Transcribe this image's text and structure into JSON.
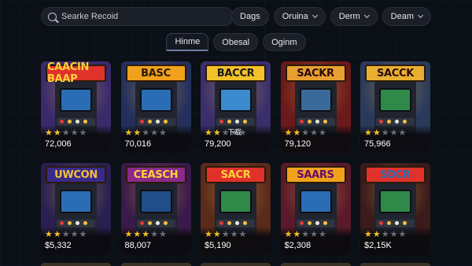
{
  "search": {
    "placeholder": "Searke Recoid"
  },
  "filters": [
    {
      "label": "Dags"
    },
    {
      "label": "Oruina"
    },
    {
      "label": "Derm"
    },
    {
      "label": "Deam"
    }
  ],
  "tabs": [
    {
      "label": "Hinme",
      "active": true
    },
    {
      "label": "Obesal",
      "active": false
    },
    {
      "label": "Oginm",
      "active": false
    }
  ],
  "colors": {
    "star_on": "#f4c21f",
    "star_off": "#6b6f78",
    "background": "#0b0f16"
  },
  "icons": {
    "search": "search-icon",
    "dropdown": "chevron-down-icon",
    "star": "star-icon"
  },
  "games": [
    {
      "title": "CAACIN BAAP",
      "rating": 2,
      "price": "72,006",
      "marquee_bg": "#e0322b",
      "marquee_fg": "#ffd23a",
      "screen": "#2a6db5",
      "theme": "#3a2a6a"
    },
    {
      "title": "BASC",
      "rating": 2,
      "price": "70,016",
      "marquee_bg": "#f0a21c",
      "marquee_fg": "#2a1a0a",
      "screen": "#2a6db5",
      "theme": "#24305c"
    },
    {
      "title": "BACCR",
      "rating": 2,
      "price": "79,200",
      "extra": "下载",
      "marquee_bg": "#f3c12a",
      "marquee_fg": "#1a1a1a",
      "screen": "#3a8ad0",
      "theme": "#3a2f6a"
    },
    {
      "title": "SACKR",
      "rating": 2,
      "price": "79,120",
      "marquee_bg": "#e8a030",
      "marquee_fg": "#2a0a0a",
      "screen": "#3a6a9a",
      "theme": "#6a1a1a"
    },
    {
      "title": "SACCK",
      "rating": 2,
      "price": "75,966",
      "marquee_bg": "#e8b030",
      "marquee_fg": "#2a0a0a",
      "screen": "#2f8a4a",
      "theme": "#2a3a5a"
    },
    {
      "title": "UWCON",
      "rating": 2,
      "price": "$5,332",
      "marquee_bg": "#3a2a8a",
      "marquee_fg": "#f2c23a",
      "screen": "#2a6db5",
      "theme": "#2a2050"
    },
    {
      "title": "CEASCH",
      "rating": 3,
      "price": "88,007",
      "marquee_bg": "#8a2a8a",
      "marquee_fg": "#ffd23a",
      "screen": "#1f4e8a",
      "theme": "#3a1a4a"
    },
    {
      "title": "SACR",
      "rating": 2,
      "price": "$5,190",
      "marquee_bg": "#e0322b",
      "marquee_fg": "#ffd23a",
      "screen": "#2f8a4a",
      "theme": "#5a2a1a"
    },
    {
      "title": "SAARS",
      "rating": 2,
      "price": "$2,308",
      "marquee_bg": "#f0a21c",
      "marquee_fg": "#6a0a6a",
      "screen": "#2a6db5",
      "theme": "#5a1a2a"
    },
    {
      "title": "SDCR",
      "rating": 2,
      "price": "$2,15K",
      "marquee_bg": "#e0322b",
      "marquee_fg": "#2a6db5",
      "screen": "#2f8a4a",
      "theme": "#3a1a1a"
    }
  ]
}
